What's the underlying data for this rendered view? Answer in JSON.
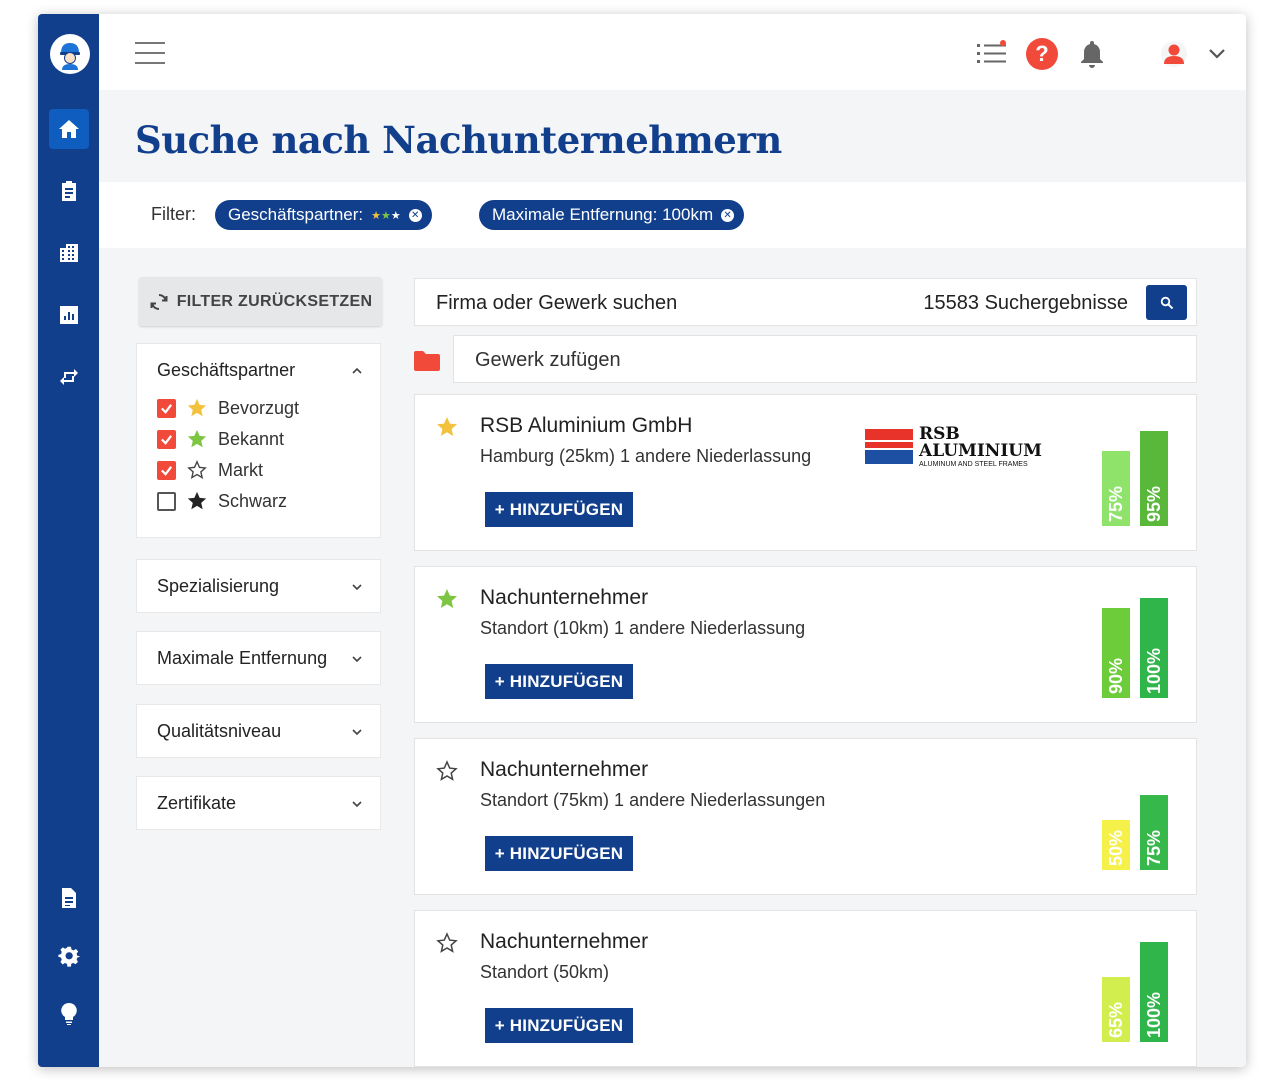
{
  "page_title": "Suche nach Nachunternehmern",
  "filter": {
    "label": "Filter:",
    "chips": [
      {
        "label": "Geschäftspartner:",
        "stars": "★★★"
      },
      {
        "label": "Maximale Entfernung: 100km",
        "stars": ""
      }
    ]
  },
  "reset_label": "FILTER ZURÜCKSETZEN",
  "partner_panel": {
    "title": "Geschäftspartner",
    "options": [
      {
        "label": "Bevorzugt",
        "checked": true,
        "star_color": "#f2c23c"
      },
      {
        "label": "Bekannt",
        "checked": true,
        "star_color": "#7ec544"
      },
      {
        "label": "Markt",
        "checked": true,
        "star_color": "outline"
      },
      {
        "label": "Schwarz",
        "checked": false,
        "star_color": "#222222"
      }
    ]
  },
  "collapsed_panels": [
    "Spezialisierung",
    "Maximale Entfernung",
    "Qualitätsniveau",
    "Zertifikate"
  ],
  "search": {
    "placeholder": "Firma oder Gewerk suchen",
    "result_count": "15583 Suchergebnisse"
  },
  "trade": {
    "placeholder": "Gewerk zufügen"
  },
  "add_label": "+ HINZUFÜGEN",
  "logo": {
    "line1": "RSB",
    "line2": "ALUMINIUM",
    "line3": "ALUMINUM AND STEEL FRAMES"
  },
  "results": [
    {
      "name": "RSB Aluminium GmbH",
      "location": "Hamburg (25km) 1 andere Niederlassung",
      "star": "#f2c23c",
      "has_logo": true,
      "bars": [
        {
          "label": "75%",
          "value": 75,
          "color": "#8fe36b"
        },
        {
          "label": "95%",
          "value": 95,
          "color": "#59b83a"
        }
      ]
    },
    {
      "name": "Nachunternehmer",
      "location": "Standort (10km) 1 andere Niederlassung",
      "star": "#7ec544",
      "has_logo": false,
      "bars": [
        {
          "label": "90%",
          "value": 90,
          "color": "#6ccc3a"
        },
        {
          "label": "100%",
          "value": 100,
          "color": "#2fb54a"
        }
      ]
    },
    {
      "name": "Nachunternehmer",
      "location": "Standort (75km) 1 andere Niederlassungen",
      "star": "outline",
      "has_logo": false,
      "bars": [
        {
          "label": "50%",
          "value": 50,
          "color": "#f5f04a"
        },
        {
          "label": "75%",
          "value": 75,
          "color": "#37b84a"
        }
      ]
    },
    {
      "name": "Nachunternehmer",
      "location": "Standort (50km)",
      "star": "outline",
      "has_logo": false,
      "bars": [
        {
          "label": "65%",
          "value": 65,
          "color": "#d2ee4e"
        },
        {
          "label": "100%",
          "value": 100,
          "color": "#2fb54a"
        }
      ]
    }
  ]
}
